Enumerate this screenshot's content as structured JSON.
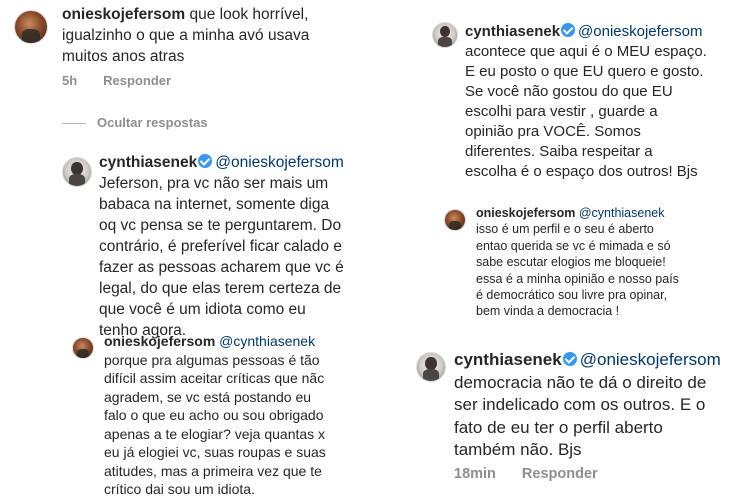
{
  "left": {
    "c1": {
      "user": "onieskojefersom",
      "lines": [
        "que look horrível,",
        "igualzinho o que a minha avó usava",
        "muitos anos atras"
      ],
      "time": "5h",
      "reply_label": "Responder"
    },
    "hide_replies": "Ocultar respostas",
    "c2": {
      "user": "cynthiasenek",
      "mention": "@onieskojefersom",
      "lines": [
        "Jeferson, pra vc não ser mais um",
        "babaca na internet, somente diga",
        "oq vc pensa se te perguntarem. Do",
        "contrário, é preferível ficar calado e",
        "fazer as pessoas acharem que vc é",
        "legal, do que elas terem certeza de",
        "que você é um idiota como eu",
        "tenho agora."
      ]
    },
    "c3": {
      "user": "onieskojefersom",
      "mention": "@cynthiasenek",
      "lines": [
        "porque pra algumas pessoas é tão",
        "difícil assim aceitar críticas que nãc",
        "agradem, se vc está postando eu",
        "falo o que eu acho ou sou obrigado",
        "apenas a te elogiar? veja quantas x",
        "eu já elogiei vc, suas roupas e suas",
        "atitudes, mas a primeira vez que te",
        "crítico dai sou um idiota."
      ]
    }
  },
  "right": {
    "c1": {
      "user": "cynthiasenek",
      "mention": "@onieskojefersom",
      "lines": [
        "acontece que aqui é o MEU espaço.",
        "E eu posto o que EU quero e gosto.",
        "Se você não gostou do que EU",
        "escolhi para vestir , guarde a",
        "opinião pra VOCÊ.  Somos",
        "diferentes. Saiba respeitar a",
        "escolha é o espaço dos outros! Bjs"
      ]
    },
    "c2": {
      "user": "onieskojefersom",
      "mention": "@cynthiasenek",
      "lines": [
        "isso é um perfil e o seu é aberto",
        "entao querida se vc é mimada e só",
        "sabe escutar elogios me bloqueie!",
        "essa é a minha opinião e nosso país",
        "é democrático sou livre pra opinar,",
        "bem vinda a democracia !"
      ]
    },
    "c3": {
      "user": "cynthiasenek",
      "mention": "@onieskojefersom",
      "lines": [
        "democracia não te dá o direito de",
        "ser indelicado com os outros. E o",
        "fato de eu ter o perfil aberto",
        "também não. Bjs"
      ],
      "time": "18min",
      "reply_label": "Responder"
    }
  },
  "colors": {
    "text": "#262626",
    "mention": "#00376b",
    "meta": "#8e8e8e",
    "verified": "#3897f0"
  },
  "icons": [
    "verified-badge-icon"
  ]
}
